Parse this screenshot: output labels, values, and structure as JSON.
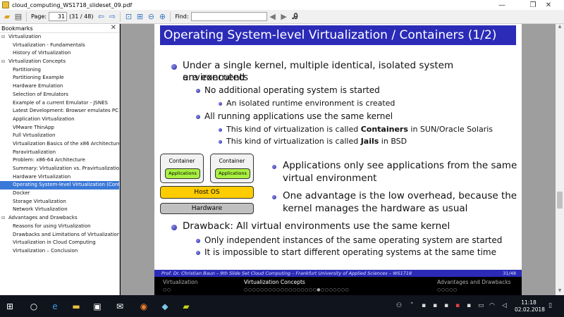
{
  "window": {
    "title": "cloud_computing_WS1718_slideset_09.pdf",
    "min_glyph": "—",
    "max_glyph": "❐",
    "close_glyph": "✕"
  },
  "toolbar": {
    "page_label": "Page:",
    "page_value": "31",
    "page_count": "(31 / 48)",
    "find_label": "Find:",
    "find_value": ""
  },
  "sidebar": {
    "header": "Bookmarks",
    "close_glyph": "✕",
    "items": [
      {
        "label": "Virtualization",
        "level": 0,
        "toggle": "⊟"
      },
      {
        "label": "Virtualization - Fundamentals",
        "level": 1
      },
      {
        "label": "History of Virtualization",
        "level": 1
      },
      {
        "label": "Virtualization Concepts",
        "level": 0,
        "toggle": "⊟"
      },
      {
        "label": "Partitioning",
        "level": 1
      },
      {
        "label": "Partitioning Example",
        "level": 1
      },
      {
        "label": "Hardware Emulation",
        "level": 1
      },
      {
        "label": "Selection of Emulators",
        "level": 1
      },
      {
        "label": "Example of a current Emulator - JSNES",
        "level": 1
      },
      {
        "label": "Latest Development: Browser emulates PC – js",
        "level": 1
      },
      {
        "label": "Application Virtualization",
        "level": 1
      },
      {
        "label": "VMware ThinApp",
        "level": 1
      },
      {
        "label": "Full Virtualization",
        "level": 1
      },
      {
        "label": "Virtualization Basics of the x86 Architecture",
        "level": 1
      },
      {
        "label": "Paravirtualization",
        "level": 1
      },
      {
        "label": "Problem: x86-64 Architecture",
        "level": 1
      },
      {
        "label": "Summary: Virtualization vs. Pravirtualization",
        "level": 1
      },
      {
        "label": "Hardware Virtualization",
        "level": 1
      },
      {
        "label": "Operating System-level Virtualization (Contair",
        "level": 1,
        "selected": true
      },
      {
        "label": "Docker",
        "level": 1
      },
      {
        "label": "Storage Virtualization",
        "level": 1
      },
      {
        "label": "Network Virtualization",
        "level": 1
      },
      {
        "label": "Advantages and Drawbacks",
        "level": 0,
        "toggle": "⊟"
      },
      {
        "label": "Reasons for using Virtualization",
        "level": 1
      },
      {
        "label": "Drawbacks and Limitations of Virtualization",
        "level": 1
      },
      {
        "label": "Virtualization in Cloud Computing",
        "level": 1
      },
      {
        "label": "Virtualization – Conclusion",
        "level": 1
      }
    ]
  },
  "slide": {
    "title": "Operating System-level Virtualization / Containers (1/2)",
    "b1_line1": "Under a single kernel, multiple identical, isolated system environments",
    "b1_line2": "are executed",
    "b1a": "No additional operating system is started",
    "b1a_i": "An isolated runtime environment is created",
    "b1b": "All running applications use the same kernel",
    "b1b_i_pre": "This kind of virtualization is called ",
    "b1b_i_bold": "Containers",
    "b1b_i_post": " in SUN/Oracle Solaris",
    "b1b_ii_pre": "This kind of virtualization is called ",
    "b1b_ii_bold": "Jails",
    "b1b_ii_post": " in BSD",
    "diagram": {
      "container_label": "Container",
      "app_label": "Applications",
      "hostos_label": "Host OS",
      "hardware_label": "Hardware",
      "colors": {
        "host_os": "#ffcc00",
        "applications": "#a8f040",
        "hardware": "#c0c0c0"
      }
    },
    "r1_line1": "Applications only see applications from the same",
    "r1_line2": "virtual environment",
    "r2_line1": "One advantage is the low overhead, because the",
    "r2_line2": "kernel manages the hardware as usual",
    "b2": "Drawback: All virtual environments use the same kernel",
    "b2a": "Only independent instances of the same operating system are started",
    "b2b": "It is impossible to start different operating systems at the same time",
    "footer_text": "Prof. Dr. Christian Baun – 9th Slide Set Cloud Computing – Frankfurt University of Applied Sciences – WS1718",
    "footer_page": "31/48",
    "nav": {
      "sec1": "Virtualization",
      "sec1_dots": "○○",
      "sec2": "Virtualization Concepts",
      "sec2_dots": "○○○○○○○○○○○○○○○○○○●○○○○○○○",
      "sec3": "Advantages and Drawbacks",
      "sec3_dots": "○○○○○"
    }
  },
  "taskbar": {
    "time": "11:18",
    "date": "02.02.2018"
  },
  "accent_color": "#2b2bb8"
}
